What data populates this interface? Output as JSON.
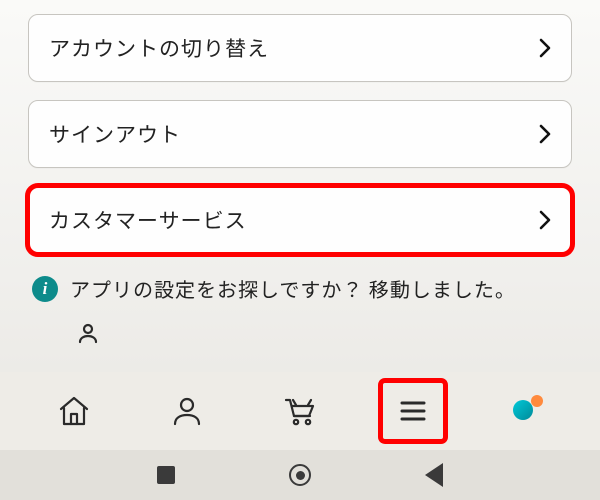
{
  "menu": {
    "items": [
      {
        "label": "アカウントの切り替え",
        "highlighted": false
      },
      {
        "label": "サインアウト",
        "highlighted": false
      },
      {
        "label": "カスタマーサービス",
        "highlighted": true
      }
    ]
  },
  "info": {
    "icon_letter": "i",
    "text": "アプリの設定をお探しですか？ 移動しました。"
  },
  "tabbar": {
    "items": [
      {
        "name": "home",
        "highlighted": false
      },
      {
        "name": "account",
        "highlighted": false
      },
      {
        "name": "cart",
        "highlighted": false
      },
      {
        "name": "menu",
        "highlighted": true
      },
      {
        "name": "assistant",
        "highlighted": false
      }
    ]
  },
  "highlight_color": "#ff0000"
}
